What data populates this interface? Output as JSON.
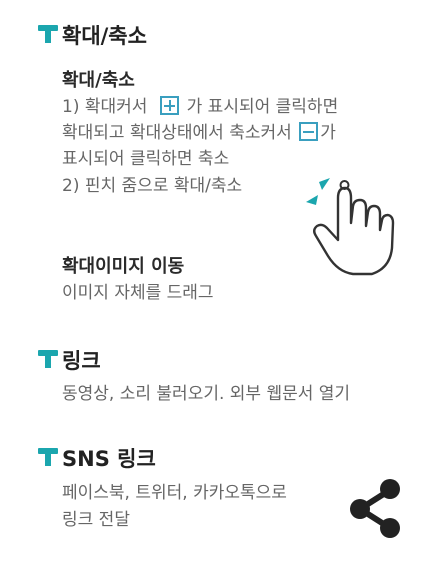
{
  "colors": {
    "accent": "#1ba6ae",
    "heading": "#222222",
    "body": "#666666",
    "icon_blue": "#3a9fbf",
    "share_icon": "#222222"
  },
  "zoom": {
    "title": "확대/축소",
    "subtitle": "확대/축소",
    "line1_pre": "1) 확대커서",
    "line1_post": "가 표시되어 클릭하면",
    "line2_pre": "확대되고 확대상태에서 축소커서",
    "line2_post": "가",
    "line3": "표시되어 클릭하면 축소",
    "line4": "2) 핀치 줌으로 확대/축소",
    "plus_icon": "plus-box-icon",
    "minus_icon": "minus-box-icon",
    "pinch_icon": "pinch-hand-icon"
  },
  "move": {
    "subtitle": "확대이미지 이동",
    "text": "이미지 자체를 드래그"
  },
  "link": {
    "title": "링크",
    "text": "동영상, 소리 불러오기. 외부 웹문서 열기"
  },
  "sns": {
    "title": "SNS 링크",
    "line1": "페이스북, 트위터, 카카오톡으로",
    "line2": "링크 전달",
    "share_icon": "share-icon"
  }
}
